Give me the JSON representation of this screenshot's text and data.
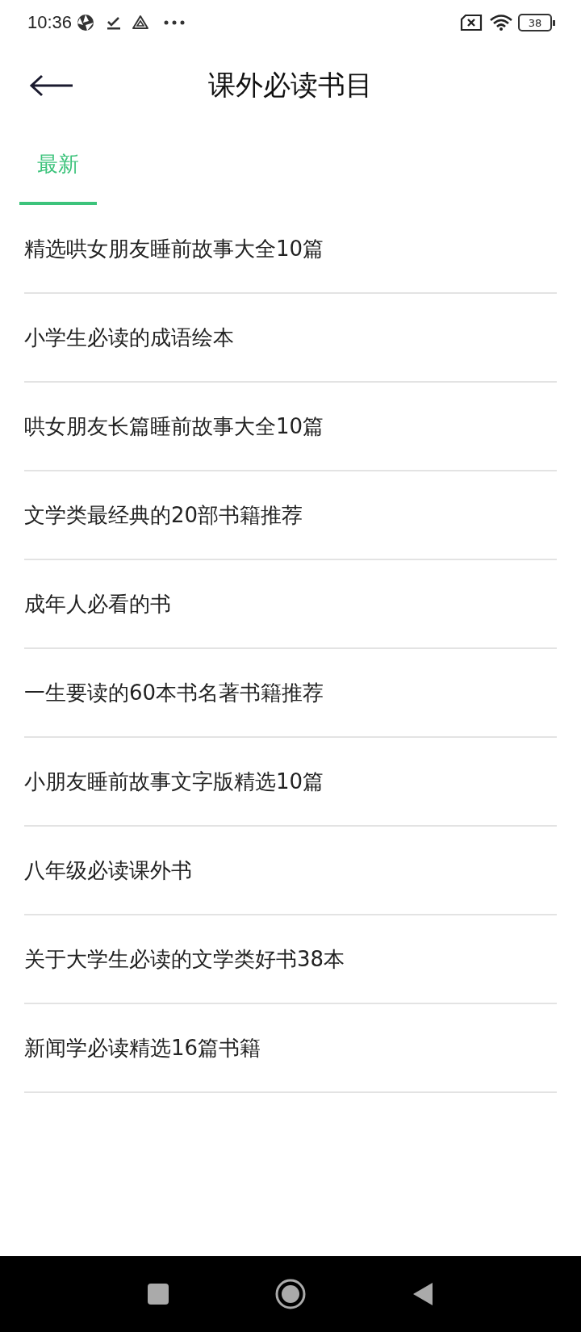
{
  "status_bar": {
    "time": "10:36",
    "battery": "38"
  },
  "header": {
    "title": "课外必读书目"
  },
  "tabs": [
    {
      "label": "最新",
      "selected": true
    }
  ],
  "items": [
    {
      "title": "精选哄女朋友睡前故事大全10篇"
    },
    {
      "title": "小学生必读的成语绘本"
    },
    {
      "title": "哄女朋友长篇睡前故事大全10篇"
    },
    {
      "title": "文学类最经典的20部书籍推荐"
    },
    {
      "title": "成年人必看的书"
    },
    {
      "title": "一生要读的60本书名著书籍推荐"
    },
    {
      "title": "小朋友睡前故事文字版精选10篇"
    },
    {
      "title": "八年级必读课外书"
    },
    {
      "title": "关于大学生必读的文学类好书38本"
    },
    {
      "title": "新闻学必读精选16篇书籍"
    }
  ]
}
